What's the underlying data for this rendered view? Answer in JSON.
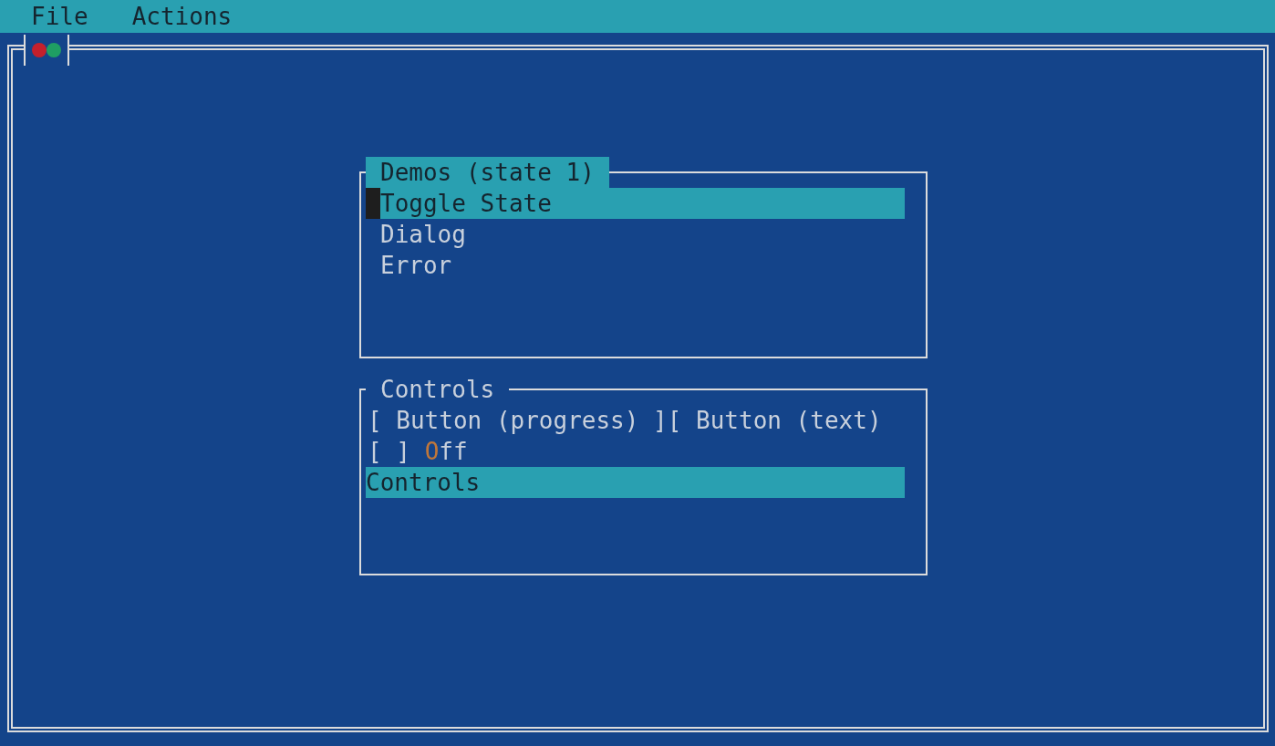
{
  "menu_bar": [
    {
      "label": "File"
    },
    {
      "label": "Actions"
    }
  ],
  "window": {
    "status_dots": [
      {
        "color": "#c4202c"
      },
      {
        "color": "#1f9e63"
      }
    ]
  },
  "panels": [
    {
      "title": "Demos (state 1)",
      "focused": true,
      "items": [
        {
          "kind": "list_item",
          "label": "Toggle State",
          "selected": true
        },
        {
          "kind": "list_item",
          "label": "Dialog",
          "selected": false
        },
        {
          "kind": "list_item",
          "label": "Error",
          "selected": false
        }
      ]
    },
    {
      "title": "Controls",
      "focused": false,
      "items": [
        {
          "kind": "buttons",
          "buttons": [
            {
              "label": "[ Button (progress) ]"
            },
            {
              "label": "[ Button (text)"
            }
          ]
        },
        {
          "kind": "checkbox",
          "box": "[ ]",
          "checked": false,
          "hotkey": "O",
          "rest": "ff"
        },
        {
          "kind": "label",
          "label": "Controls",
          "selected": true
        }
      ]
    }
  ]
}
